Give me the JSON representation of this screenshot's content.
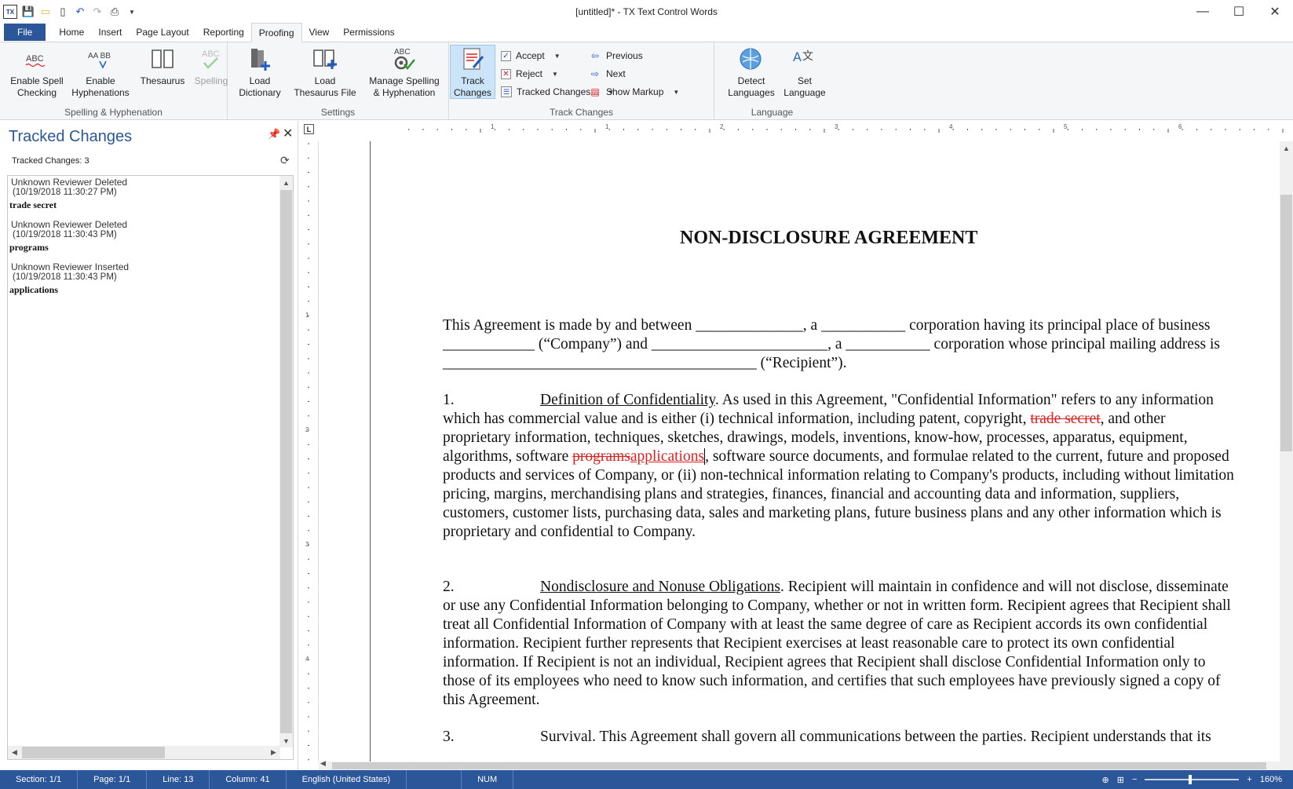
{
  "window": {
    "title": "[untitled]* - TX Text Control Words",
    "minimize": "—",
    "maximize": "☐",
    "close": "✕"
  },
  "qat": {
    "logo": "TX",
    "icons": [
      "save-icon",
      "open-folder-icon",
      "new-document-icon",
      "undo-icon",
      "redo-icon",
      "print-icon",
      "customize-qat-icon"
    ]
  },
  "tabs": [
    "File",
    "Home",
    "Insert",
    "Page Layout",
    "Reporting",
    "Proofing",
    "View",
    "Permissions"
  ],
  "active_tab": "Proofing",
  "ribbon": {
    "groups": {
      "spelling": "Spelling & Hyphenation",
      "settings": "Settings",
      "track": "Track Changes",
      "language": "Language"
    },
    "buttons": {
      "enable_spell": "Enable Spell\nChecking",
      "enable_spell_l1": "Enable Spell",
      "enable_spell_l2": "Checking",
      "enable_hyph_l1": "Enable",
      "enable_hyph_l2": "Hyphenations",
      "thesaurus": "Thesaurus",
      "spelling": "Spelling",
      "load_dict_l1": "Load",
      "load_dict_l2": "Dictionary",
      "load_thes_l1": "Load",
      "load_thes_l2": "Thesaurus File",
      "manage_l1": "Manage Spelling",
      "manage_l2": "& Hyphenation",
      "track_l1": "Track",
      "track_l2": "Changes",
      "accept": "Accept",
      "reject": "Reject",
      "tracked_changes": "Tracked Changes...",
      "previous": "Previous",
      "next": "Next",
      "show_markup": "Show Markup",
      "detect_l1": "Detect",
      "detect_l2": "Languages",
      "set_l1": "Set",
      "set_l2": "Language"
    },
    "icon_text": {
      "abc": "ABC",
      "aabb": "AA BB"
    }
  },
  "pane": {
    "title": "Tracked Changes",
    "count_label": "Tracked Changes: 3",
    "items": [
      {
        "who": "Unknown Reviewer Deleted",
        "when": "(10/19/2018 11:30:27 PM)",
        "word": "trade secret"
      },
      {
        "who": "Unknown Reviewer Deleted",
        "when": "(10/19/2018 11:30:43 PM)",
        "word": "programs"
      },
      {
        "who": "Unknown Reviewer Inserted",
        "when": "(10/19/2018 11:30:43 PM)",
        "word": "applications"
      }
    ]
  },
  "ruler": {
    "h_numbers": [
      "1",
      "1",
      "2",
      "3",
      "4",
      "5",
      "6"
    ],
    "v_numbers": [
      "1",
      "2",
      "3",
      "4"
    ]
  },
  "document": {
    "title": "NON-DISCLOSURE AGREEMENT",
    "p1": {
      "l1": "This Agreement is made by and between ______________, a ___________ corporation having its principal place of business",
      "l2": "____________ (“Company”) and _______________________, a ___________ corporation whose principal mailing address is",
      "l3": "_________________________________________ (“Recipient”)."
    },
    "s1": {
      "num": "1.",
      "heading": "Definition of Confidentiality",
      "l1_rest": ". As used in this Agreement, \"Confidential Information\" refers to any information",
      "l2_a": "which has commercial value and is either (i) technical information, including patent, copyright, ",
      "l2_del": "trade secret",
      "l2_b": ", and other",
      "l3": "proprietary information, techniques, sketches, drawings, models, inventions, know-how, processes, apparatus, equipment,",
      "l4_a": "algorithms, software ",
      "l4_del": "programs",
      "l4_ins": "applications",
      "l4_b": ", software source documents, and formulae related to the current, future and proposed",
      "l5": "products and services of Company, or (ii) non-technical information relating to Company's products, including without limitation",
      "l6": "pricing, margins, merchandising plans and strategies, finances, financial and accounting data and information, suppliers,",
      "l7": "customers, customer lists, purchasing data, sales and marketing plans, future business plans and any other information which is",
      "l8": "proprietary and confidential to Company."
    },
    "s2": {
      "num": "2.",
      "heading": "Nondisclosure and Nonuse Obligations",
      "l1_rest": ". Recipient will maintain in confidence and will not disclose, disseminate",
      "l2": "or use any Confidential Information belonging to Company, whether or not in written form.  Recipient agrees that Recipient shall",
      "l3": "treat all Confidential Information of Company with at least the same degree of care as Recipient accords its own confidential",
      "l4": "information.  Recipient further represents that Recipient exercises at least reasonable care to protect its own confidential",
      "l5": "information.  If Recipient is not an individual, Recipient agrees that Recipient shall disclose Confidential Information only to",
      "l6": "those of its employees who need to know such information, and certifies that such employees have previously signed a copy of",
      "l7": "this Agreement."
    },
    "s3": {
      "num": "3.",
      "heading": "Survival",
      "l1_rest": ".  This Agreement shall govern all communications between the parties.  Recipient understands that its"
    }
  },
  "status": {
    "section": "Section: 1/1",
    "page": "Page: 1/1",
    "line": "Line: 13",
    "column": "Column: 41",
    "language": "English (United States)",
    "num": "NUM",
    "zoom": "160%",
    "zoom_level_percent": 160
  },
  "colors": {
    "accent": "#2b579a",
    "tracked_change": "#e02020"
  }
}
